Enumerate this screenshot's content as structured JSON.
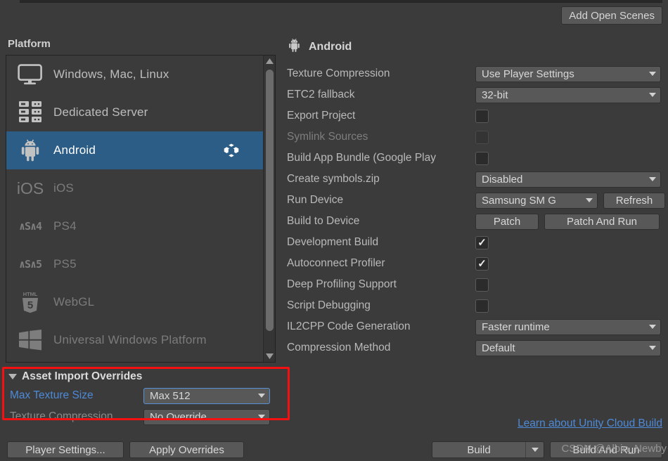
{
  "toolbar": {
    "add_open_scenes": "Add Open Scenes"
  },
  "platform": {
    "section_label": "Platform",
    "items": [
      {
        "label": "Windows, Mac, Linux",
        "icon": "monitor-icon",
        "selected": false,
        "dim": false,
        "unity_mark": false
      },
      {
        "label": "Dedicated Server",
        "icon": "server-icon",
        "selected": false,
        "dim": false,
        "unity_mark": false
      },
      {
        "label": "Android",
        "icon": "android-icon",
        "selected": true,
        "dim": false,
        "unity_mark": true
      },
      {
        "label": "iOS",
        "icon": "ios-icon",
        "selected": false,
        "dim": true,
        "unity_mark": false
      },
      {
        "label": "PS4",
        "icon": "ps4-icon",
        "selected": false,
        "dim": true,
        "unity_mark": false
      },
      {
        "label": "PS5",
        "icon": "ps5-icon",
        "selected": false,
        "dim": true,
        "unity_mark": false
      },
      {
        "label": "WebGL",
        "icon": "html5-icon",
        "selected": false,
        "dim": true,
        "unity_mark": false
      },
      {
        "label": "Universal Windows Platform",
        "icon": "windows-icon",
        "selected": false,
        "dim": true,
        "unity_mark": false
      }
    ]
  },
  "settings": {
    "title": "Android",
    "title_icon": "android-icon",
    "rows": [
      {
        "label": "Texture Compression",
        "type": "dropdown",
        "value": "Use Player Settings",
        "dim": false
      },
      {
        "label": "ETC2 fallback",
        "type": "dropdown",
        "value": "32-bit",
        "dim": false
      },
      {
        "label": "Export Project",
        "type": "checkbox",
        "checked": false,
        "dim": false
      },
      {
        "label": "Symlink Sources",
        "type": "checkbox",
        "checked": false,
        "dim": true
      },
      {
        "label": "Build App Bundle (Google Play",
        "type": "checkbox",
        "checked": false,
        "dim": false
      },
      {
        "label": "Create symbols.zip",
        "type": "dropdown",
        "value": "Disabled",
        "dim": false
      },
      {
        "label": "Run Device",
        "type": "device",
        "value": "Samsung SM G",
        "button": "Refresh",
        "dim": false
      },
      {
        "label": "Build to Device",
        "type": "buttons",
        "buttons": [
          "Patch",
          "Patch And Run"
        ],
        "dim": false
      },
      {
        "label": "Development Build",
        "type": "checkbox",
        "checked": true,
        "dim": false
      },
      {
        "label": "Autoconnect Profiler",
        "type": "checkbox",
        "checked": true,
        "dim": false
      },
      {
        "label": "Deep Profiling Support",
        "type": "checkbox",
        "checked": false,
        "dim": false
      },
      {
        "label": "Script Debugging",
        "type": "checkbox",
        "checked": false,
        "dim": false
      },
      {
        "label": "IL2CPP Code Generation",
        "type": "dropdown",
        "value": "Faster runtime",
        "dim": false
      },
      {
        "label": "Compression Method",
        "type": "dropdown",
        "value": "Default",
        "dim": false
      }
    ]
  },
  "asset_import_overrides": {
    "title": "Asset Import Overrides",
    "expanded": true,
    "rows": [
      {
        "label": "Max Texture Size",
        "value": "Max 512",
        "focused": true,
        "highlight": true
      },
      {
        "label": "Texture Compression",
        "value": "No Override",
        "focused": false,
        "highlight": false
      }
    ]
  },
  "footer": {
    "player_settings": "Player Settings...",
    "apply_overrides": "Apply Overrides",
    "cloud_build_link": "Learn about Unity Cloud Build",
    "build": "Build",
    "build_and_run": "Build And Run",
    "watermark": "CSDN @Albin_Newby"
  },
  "colors": {
    "background": "#3b3b3b",
    "selection": "#2c5d87",
    "accent_link": "#4d8ad8",
    "highlight_box": "#f51111",
    "control": "#585858"
  }
}
